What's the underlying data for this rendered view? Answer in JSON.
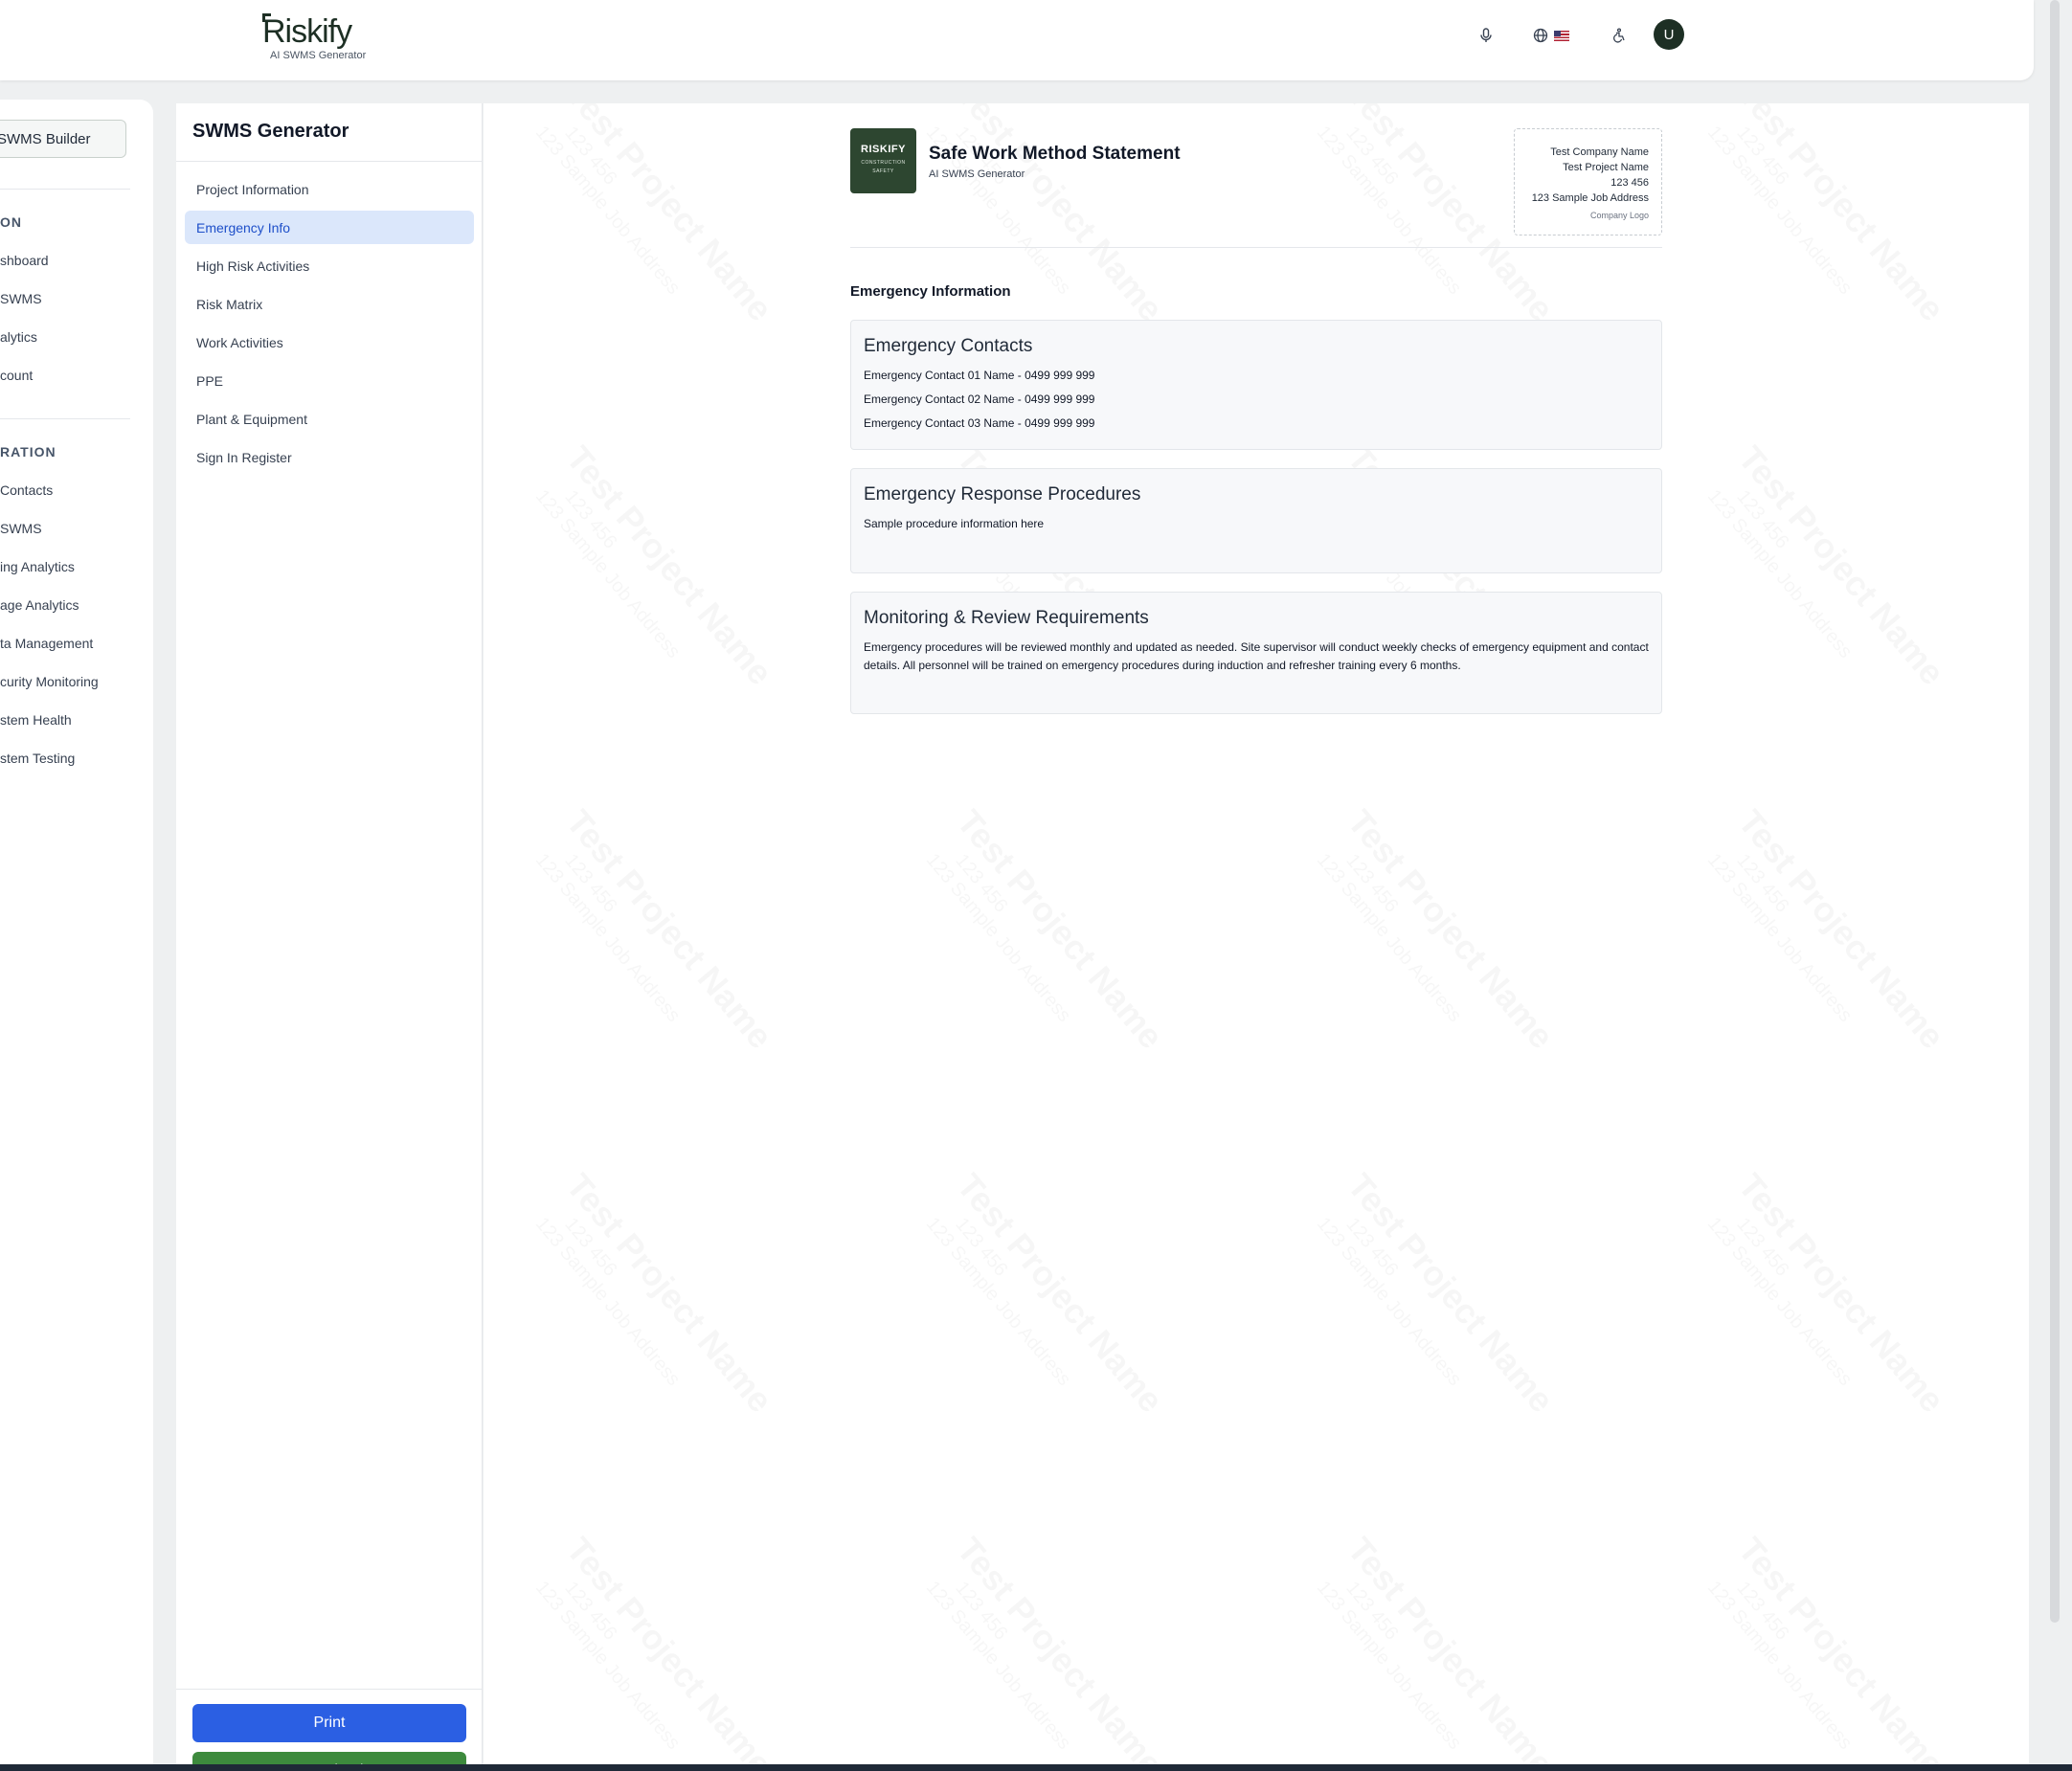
{
  "header": {
    "logo_text": "Riskify",
    "logo_subtitle": "AI SWMS Generator",
    "mic_icon": "microphone-icon",
    "language_icon": "globe-icon",
    "accessibility_icon": "accessibility-icon",
    "avatar_initial": "U"
  },
  "app_sidebar": {
    "builder_button": "SWMS Builder",
    "section1_heading": "ON",
    "section1_items": [
      "shboard",
      "SWMS",
      "alytics",
      "count"
    ],
    "section2_heading": "RATION",
    "section2_items": [
      "Contacts",
      "SWMS",
      "ing Analytics",
      "age Analytics",
      "ta Management",
      "curity Monitoring",
      "stem Health",
      "stem Testing"
    ]
  },
  "generator": {
    "title": "SWMS Generator",
    "nav": [
      {
        "label": "Project Information",
        "active": false
      },
      {
        "label": "Emergency Info",
        "active": true
      },
      {
        "label": "High Risk Activities",
        "active": false
      },
      {
        "label": "Risk Matrix",
        "active": false
      },
      {
        "label": "Work Activities",
        "active": false
      },
      {
        "label": "PPE",
        "active": false
      },
      {
        "label": "Plant & Equipment",
        "active": false
      },
      {
        "label": "Sign In Register",
        "active": false
      }
    ],
    "print_label": "Print",
    "download_label": "Download"
  },
  "document": {
    "logo_line1": "RISKIFY",
    "logo_line2": "CONSTRUCTION",
    "logo_line3": "SAFETY",
    "title": "Safe Work Method Statement",
    "subtitle": "AI SWMS Generator",
    "company": {
      "name": "Test Company Name",
      "project": "Test Project Name",
      "number": "123 456",
      "address": "123 Sample Job Address",
      "logo_label": "Company Logo"
    },
    "section_title": "Emergency Information",
    "contacts_heading": "Emergency Contacts",
    "contacts": [
      "Emergency Contact 01 Name - 0499 999 999",
      "Emergency Contact 02 Name - 0499 999 999",
      "Emergency Contact 03 Name - 0499 999 999"
    ],
    "procedures_heading": "Emergency Response Procedures",
    "procedures_text": "Sample procedure information here",
    "monitoring_heading": "Monitoring & Review Requirements",
    "monitoring_text": "Emergency procedures will be reviewed monthly and updated as needed. Site supervisor will conduct weekly checks of emergency equipment and contact details. All personnel will be trained on emergency procedures during induction and refresher training every 6 months."
  },
  "watermark": {
    "line1": "Test Project Name",
    "line2": "123 456",
    "line3": "123 Sample Job Address"
  },
  "colors": {
    "brand_dark_green": "#1d2f24",
    "active_nav_bg": "#dbe7fb",
    "active_nav_text": "#1e4fc9",
    "print_button": "#2b5fe3",
    "download_button": "#3d8a3d"
  }
}
